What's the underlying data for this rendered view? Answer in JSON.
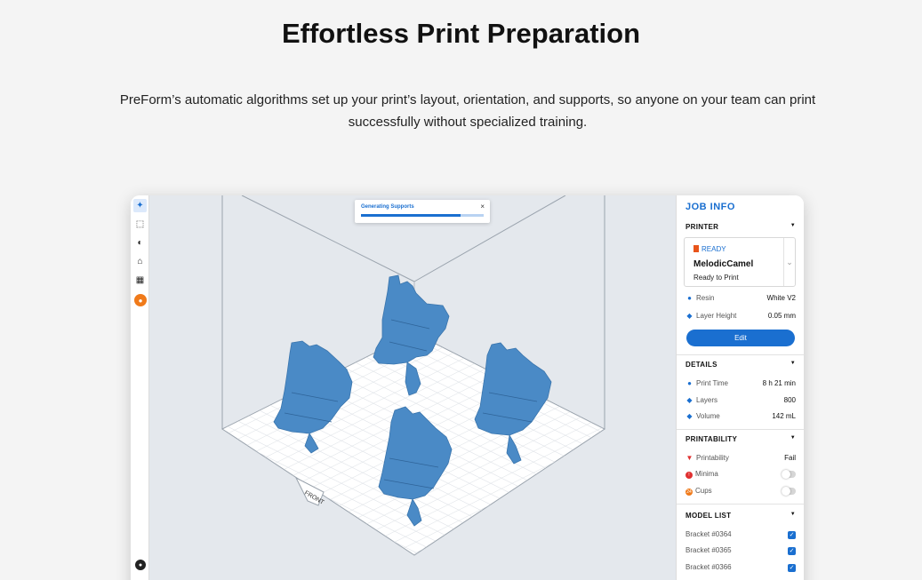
{
  "hero": {
    "title": "Effortless Print Preparation",
    "subtitle": "PreForm’s automatic algorithms set up your print’s layout, orientation, and supports, so anyone on your team can print successfully without specialized training."
  },
  "toolbar": {
    "tools": [
      "magic-wand-icon",
      "select-icon",
      "orientation-icon",
      "supports-icon",
      "layout-icon",
      "print-icon"
    ],
    "account_icon": "account-icon"
  },
  "viewport": {
    "platform_label": "FRONT",
    "model_color": "#4a8ac6",
    "toast": {
      "label": "Generating Supports",
      "close": "×",
      "progress": 0.81
    }
  },
  "panel": {
    "title": "JOB INFO",
    "printer": {
      "heading": "PRINTER",
      "status": "READY",
      "name": "MelodicCamel",
      "state": "Ready to Print",
      "resin_label": "Resin",
      "resin_value": "White V2",
      "layer_label": "Layer Height",
      "layer_value": "0.05 mm",
      "edit_label": "Edit"
    },
    "details": {
      "heading": "DETAILS",
      "print_time_label": "Print Time",
      "print_time_value": "8 h 21 min",
      "layers_label": "Layers",
      "layers_value": "800",
      "volume_label": "Volume",
      "volume_value": "142 mL"
    },
    "printability": {
      "heading": "PRINTABILITY",
      "printability_label": "Printability",
      "printability_value": "Fail",
      "minima_label": "Minima",
      "cups_label": "Cups",
      "cups_badge": "24"
    },
    "model_list": {
      "heading": "MODEL LIST",
      "items": [
        "Bracket #0364",
        "Bracket #0365",
        "Bracket #0366"
      ]
    }
  },
  "colors": {
    "accent": "#1a6fd0",
    "warning": "#f07a1a",
    "fail": "#e03030"
  }
}
